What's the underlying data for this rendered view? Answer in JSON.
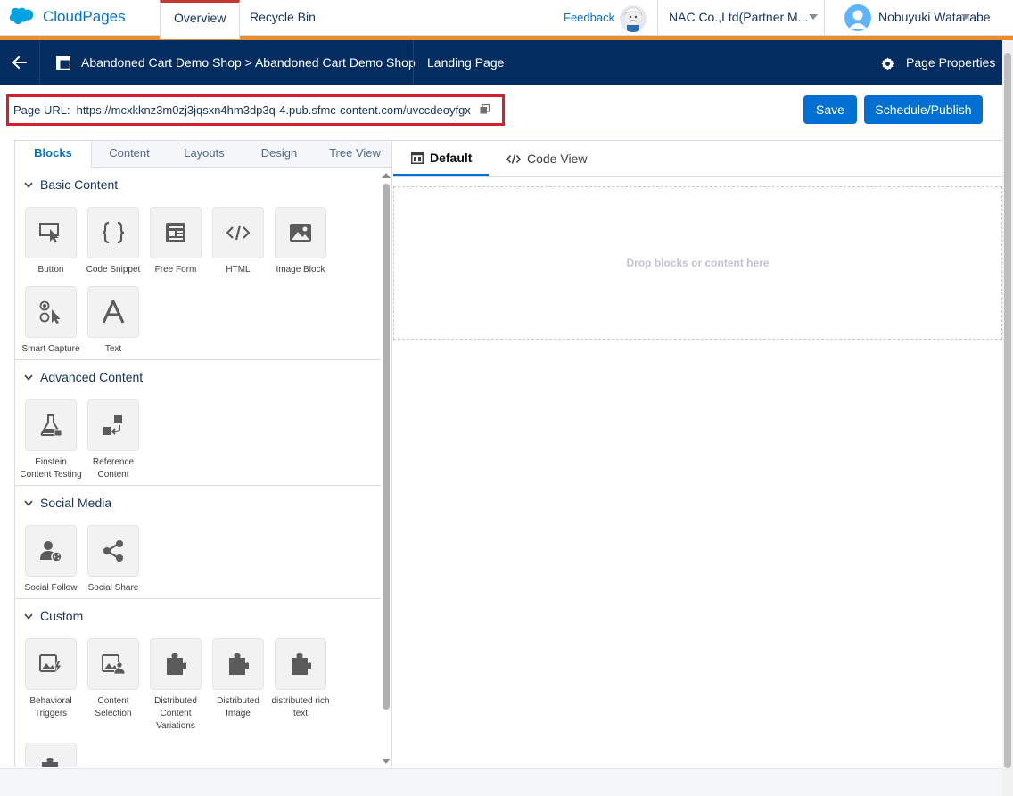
{
  "app": {
    "name": "CloudPages"
  },
  "top_tabs": [
    {
      "label": "Overview",
      "active": true
    },
    {
      "label": "Recycle Bin",
      "active": false
    }
  ],
  "header": {
    "feedback": "Feedback",
    "org": "NAC Co.,Ltd(Partner M...",
    "user": "Nobuyuki Watanabe"
  },
  "nav": {
    "breadcrumb": "Abandoned Cart Demo Shop > Abandoned Cart Demo Shop",
    "page_type": "Landing Page",
    "properties": "Page Properties"
  },
  "url_row": {
    "label": "Page URL:",
    "url": "https://mcxkknz3m0zj3jqsxn4hm3dp3q-4.pub.sfmc-content.com/uvccdeoyfgx"
  },
  "buttons": {
    "save": "Save",
    "publish": "Schedule/Publish"
  },
  "left_tabs": [
    "Blocks",
    "Content",
    "Layouts",
    "Design",
    "Tree View"
  ],
  "sections": [
    {
      "title": "Basic Content",
      "blocks": [
        {
          "label": "Button",
          "icon": "button-cursor-icon"
        },
        {
          "label": "Code Snippet",
          "icon": "braces-icon"
        },
        {
          "label": "Free Form",
          "icon": "free-form-icon"
        },
        {
          "label": "HTML",
          "icon": "code-icon"
        },
        {
          "label": "Image Block",
          "icon": "image-icon"
        },
        {
          "label": "Smart Capture",
          "icon": "smart-capture-icon"
        },
        {
          "label": "Text",
          "icon": "text-icon"
        }
      ]
    },
    {
      "title": "Advanced Content",
      "blocks": [
        {
          "label": "Einstein Content Testing",
          "icon": "flask-icon"
        },
        {
          "label": "Reference Content",
          "icon": "reference-icon"
        }
      ]
    },
    {
      "title": "Social Media",
      "blocks": [
        {
          "label": "Social Follow",
          "icon": "social-follow-icon"
        },
        {
          "label": "Social Share",
          "icon": "share-icon"
        }
      ]
    },
    {
      "title": "Custom",
      "blocks": [
        {
          "label": "Behavioral Triggers",
          "icon": "image-lightning-icon"
        },
        {
          "label": "Content Selection",
          "icon": "image-person-icon"
        },
        {
          "label": "Distributed Content Variations",
          "icon": "puzzle-icon"
        },
        {
          "label": "Distributed Image",
          "icon": "puzzle-icon"
        },
        {
          "label": "distributed rich text",
          "icon": "puzzle-icon"
        }
      ]
    }
  ],
  "canvas": {
    "tabs": [
      {
        "label": "Default",
        "active": true
      },
      {
        "label": "Code View",
        "active": false
      }
    ],
    "drop_text": "Drop blocks or content here"
  },
  "colors": {
    "accent": "#0070d2",
    "nav_bg": "#032d60",
    "highlight": "#d4202e",
    "brand_bar": "#e98e2c"
  }
}
